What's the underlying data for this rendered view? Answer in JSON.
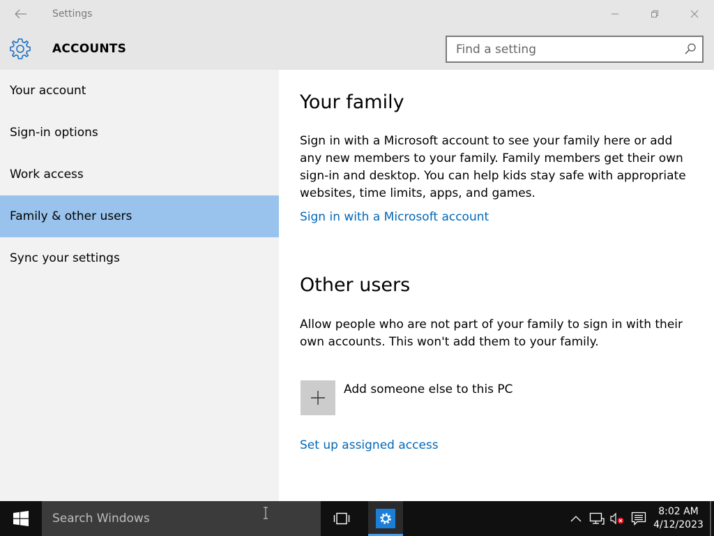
{
  "window": {
    "app_title": "Settings"
  },
  "header": {
    "page_title": "ACCOUNTS",
    "search_placeholder": "Find a setting"
  },
  "sidebar": {
    "items": [
      {
        "label": "Your account"
      },
      {
        "label": "Sign-in options"
      },
      {
        "label": "Work access"
      },
      {
        "label": "Family & other users",
        "selected": true
      },
      {
        "label": "Sync your settings"
      }
    ]
  },
  "content": {
    "family": {
      "title": "Your family",
      "description": "Sign in with a Microsoft account to see your family here or add any new members to your family. Family members get their own sign-in and desktop. You can help kids stay safe with appropriate websites, time limits, apps, and games.",
      "link": "Sign in with a Microsoft account"
    },
    "other_users": {
      "title": "Other users",
      "description": "Allow people who are not part of your family to sign in with their own accounts. This won't add them to your family.",
      "add_label": "Add someone else to this PC",
      "assigned_access_link": "Set up assigned access"
    }
  },
  "taskbar": {
    "search_placeholder": "Search Windows",
    "time": "8:02 AM",
    "date": "4/12/2023"
  },
  "colors": {
    "accent": "#0067b8",
    "selected_item": "#99c3ec",
    "taskbar": "#101010"
  }
}
